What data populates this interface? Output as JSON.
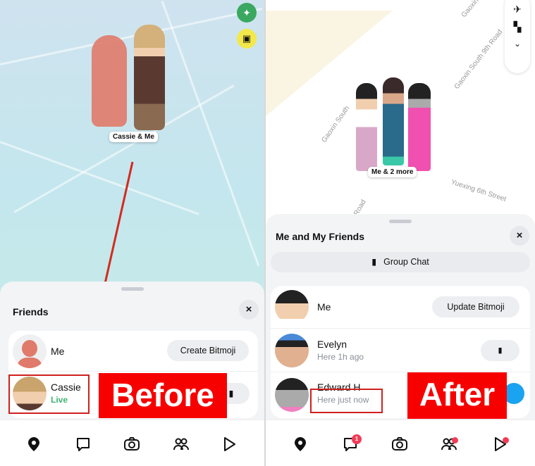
{
  "left": {
    "map": {
      "avatar_label": "Cassie & Me",
      "controls": [
        "satellite-icon",
        "cards-icon"
      ]
    },
    "sheet": {
      "title": "Friends",
      "close_label": "×",
      "rows": [
        {
          "name": "Me",
          "button": "Create Bitmoji"
        },
        {
          "name": "Cassie",
          "status": "Live",
          "status_color": "#3cb371"
        }
      ]
    },
    "annotation": "Before",
    "nav": [
      "map-icon",
      "chat-icon",
      "camera-icon",
      "friends-icon",
      "stories-icon"
    ]
  },
  "right": {
    "map": {
      "avatar_label": "Me & 2 more",
      "streets": [
        "Gaoxin",
        "Gaoxin South 9th Road",
        "Gaoxin South",
        "Yuexing 6th Street",
        "Road"
      ]
    },
    "sheet": {
      "title": "Me and My Friends",
      "close_label": "×",
      "group_chat": "Group Chat",
      "rows": [
        {
          "name": "Me",
          "button": "Update Bitmoji"
        },
        {
          "name": "Evelyn",
          "status": "Here 1h ago"
        },
        {
          "name": "Edward H",
          "status": "Here just now"
        }
      ]
    },
    "annotation": "After",
    "nav": [
      "map-icon",
      "chat-icon",
      "camera-icon",
      "friends-icon",
      "stories-icon"
    ],
    "chat_badge": "1"
  },
  "colors": {
    "annotation_red": "#f70000",
    "badge": "#f23c57",
    "accent_blue": "#1aa3f0"
  }
}
